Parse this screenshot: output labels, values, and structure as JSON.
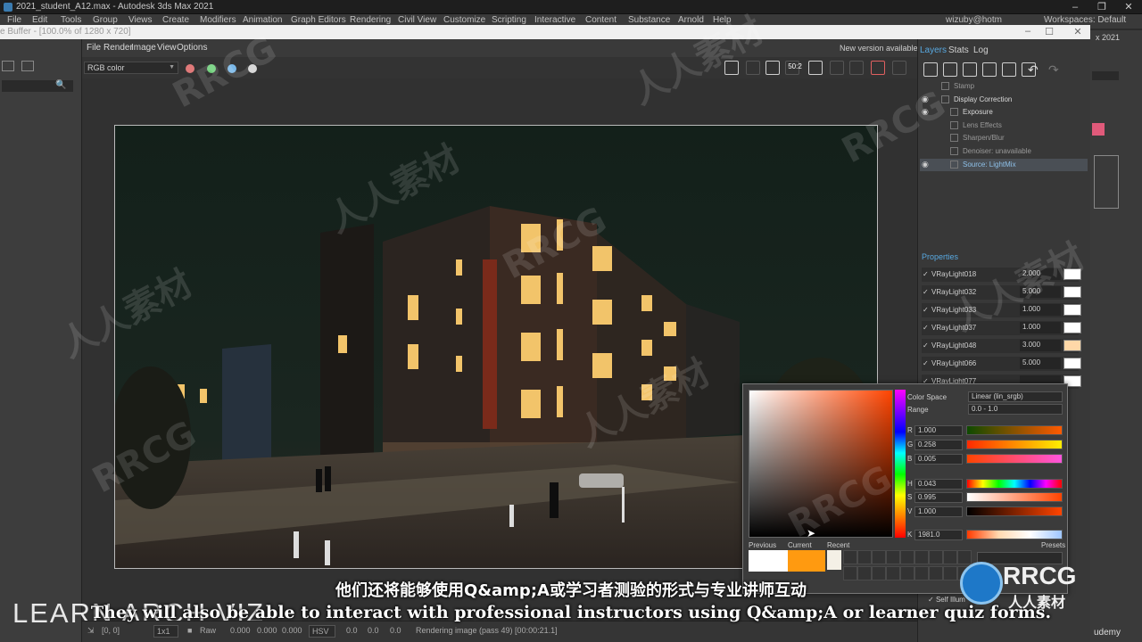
{
  "app": {
    "title": "2021_student_A12.max - Autodesk 3ds Max 2021",
    "menu": [
      "File",
      "Edit",
      "Tools",
      "Group",
      "Views",
      "Create",
      "Modifiers",
      "Animation",
      "Graph Editors",
      "Rendering",
      "Civil View",
      "Customize",
      "Scripting",
      "Interactive",
      "Content",
      "Substance",
      "Arnold",
      "Help"
    ],
    "user": "wizuby@hotm",
    "workspaces_label": "Workspaces:",
    "workspaces_value": "Default",
    "workspace_2021": "x 2021"
  },
  "vfb": {
    "window_title": "e Buffer - [100.0% of 1280 x 720]",
    "menu": [
      "File",
      "Render",
      "Image",
      "View",
      "Options"
    ],
    "new_version": "New version available!",
    "channel": "RGB color",
    "dots": [
      "#e07a7a",
      "#6fd07a",
      "#7ab8e8",
      "#d8d8d8"
    ],
    "toolbar_sample_label": "50:2",
    "status": {
      "zoom": "1x1",
      "coords": "[0, 0]",
      "raw_label": "Raw",
      "r": "0.000",
      "g": "0.000",
      "b": "0.000",
      "mode": "HSV",
      "h": "0.0",
      "s": "0.0",
      "v": "0.0",
      "message": "Rendering image (pass 49) [00:00:21.1]"
    }
  },
  "layers": {
    "tabs": [
      "Layers",
      "Stats",
      "Log"
    ],
    "items": [
      {
        "label": "Stamp",
        "eye": false,
        "indent": 1,
        "state": "dim"
      },
      {
        "label": "Display Correction",
        "eye": true,
        "indent": 1,
        "state": "bright"
      },
      {
        "label": "Exposure",
        "eye": true,
        "indent": 2,
        "state": "bright"
      },
      {
        "label": "Lens Effects",
        "eye": false,
        "indent": 2,
        "state": "dim"
      },
      {
        "label": "Sharpen/Blur",
        "eye": false,
        "indent": 2,
        "state": "dim"
      },
      {
        "label": "Denoiser: unavailable",
        "eye": false,
        "indent": 2,
        "state": "dim"
      },
      {
        "label": "Source: LightMix",
        "eye": true,
        "indent": 2,
        "state": "selected"
      }
    ],
    "properties_title": "Properties",
    "lights": [
      {
        "name": "VRayLight018",
        "value": "2.000",
        "color": "#ffffff"
      },
      {
        "name": "VRayLight032",
        "value": "5.000",
        "color": "#ffffff"
      },
      {
        "name": "VRayLight033",
        "value": "1.000",
        "color": "#ffffff"
      },
      {
        "name": "VRayLight037",
        "value": "1.000",
        "color": "#ffffff"
      },
      {
        "name": "VRayLight048",
        "value": "3.000",
        "color": "#ffd8a8"
      },
      {
        "name": "VRayLight066",
        "value": "5.000",
        "color": "#ffffff"
      },
      {
        "name": "VRayLight077",
        "value": "",
        "color": "#ffffff"
      }
    ]
  },
  "picker": {
    "color_space_label": "Color Space",
    "color_space_value": "Linear (lin_srgb)",
    "range_label": "Range",
    "range_value": "0.0 - 1.0",
    "channels": [
      {
        "k": "R",
        "v": "1.000"
      },
      {
        "k": "G",
        "v": "0.258"
      },
      {
        "k": "B",
        "v": "0.005"
      },
      {
        "k": "H",
        "v": "0.043"
      },
      {
        "k": "S",
        "v": "0.995"
      },
      {
        "k": "V",
        "v": "1.000"
      },
      {
        "k": "K",
        "v": "1981.0"
      }
    ],
    "previous_label": "Previous",
    "current_label": "Current",
    "recent_label": "Recent",
    "presets_label": "Presets",
    "previous_color": "#ffffff",
    "current_color": "#ff9a10",
    "recent_color": "#f4f0e6",
    "self_illum_label": "Self Illum"
  },
  "overlay": {
    "learn_arch": "LEARN ARCH VIZ",
    "subtitle_cn": "他们还将能够使用Q&amp;A或学习者测验的形式与专业讲师互动",
    "subtitle_en": "They will also be able to interact with professional instructors using Q&amp;A or learner quiz forms.",
    "brand": "RRCG",
    "brand_cn": "人人素材",
    "udemy": "udemy",
    "watermark_en": "RRCG",
    "watermark_cn": "人人素材"
  }
}
